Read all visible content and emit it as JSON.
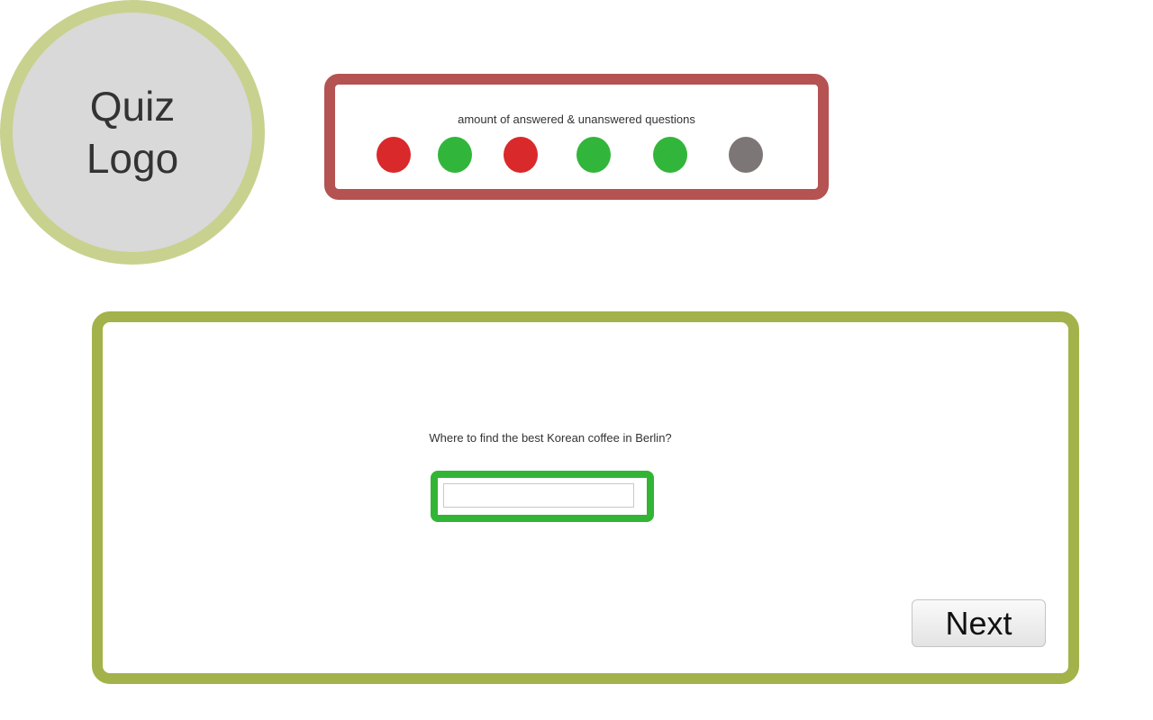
{
  "logo": {
    "text": "Quiz Logo"
  },
  "progress": {
    "title": "amount of answered & unanswered questions",
    "dots": [
      {
        "status": "wrong",
        "color": "#d9292b"
      },
      {
        "status": "correct",
        "color": "#32b53b"
      },
      {
        "status": "wrong",
        "color": "#d9292b"
      },
      {
        "status": "correct",
        "color": "#32b53b"
      },
      {
        "status": "correct",
        "color": "#32b53b"
      },
      {
        "status": "unanswered",
        "color": "#7d7676"
      }
    ]
  },
  "question": {
    "text": "Where to find the best Korean coffee in Berlin?",
    "answer_value": ""
  },
  "actions": {
    "next_label": "Next"
  },
  "colors": {
    "logo_ring": "#c9d18f",
    "logo_fill": "#d9d9d9",
    "progress_border": "#b55252",
    "question_border": "#a3b24a",
    "answer_border": "#32b535"
  }
}
